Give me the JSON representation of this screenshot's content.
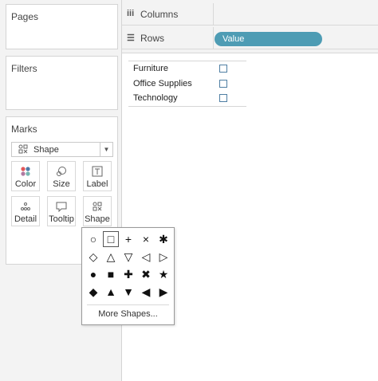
{
  "cards": {
    "pages": "Pages",
    "filters": "Filters",
    "marks": "Marks"
  },
  "marks": {
    "mark_type": "Shape",
    "mark_type_icon": "shape-grid-icon",
    "buttons": [
      {
        "label": "Color",
        "icon": "color-dots-icon"
      },
      {
        "label": "Size",
        "icon": "size-icon"
      },
      {
        "label": "Label",
        "icon": "label-icon"
      },
      {
        "label": "Detail",
        "icon": "detail-dots-icon"
      },
      {
        "label": "Tooltip",
        "icon": "tooltip-icon"
      },
      {
        "label": "Shape",
        "icon": "shape-grid-icon"
      }
    ]
  },
  "shelves": {
    "columns": "Columns",
    "rows": "Rows",
    "rows_pill": "Value"
  },
  "legend": {
    "items": [
      "Furniture",
      "Office Supplies",
      "Technology"
    ]
  },
  "shape_popup": {
    "shapes": [
      "○",
      "□",
      "+",
      "×",
      "✱",
      "◇",
      "△",
      "▽",
      "◁",
      "▷",
      "●",
      "■",
      "✚",
      "✖",
      "★",
      "◆",
      "▲",
      "▼",
      "◀",
      "▶"
    ],
    "selected_index": 1,
    "more_label": "More Shapes..."
  },
  "colors": {
    "pill": "#4e9cb4",
    "legend_mark": "#4e7ea3"
  }
}
